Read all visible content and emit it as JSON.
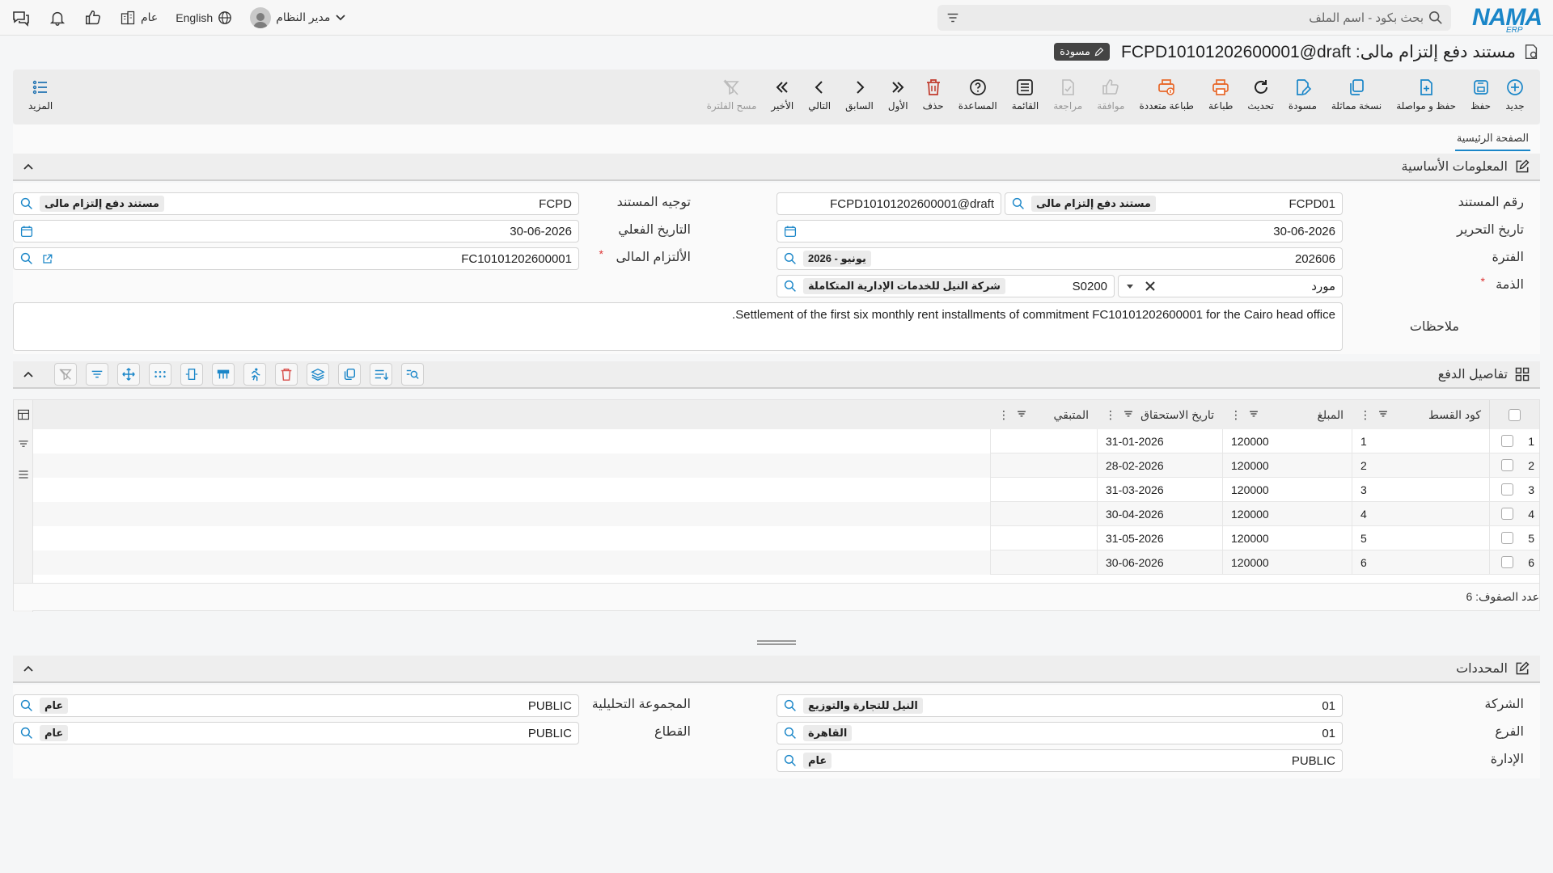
{
  "topbar": {
    "logo_text": "NAMA",
    "logo_sub": "ERP",
    "search_placeholder": "بحث بكود - اسم الملف",
    "user_name": "مدير النظام",
    "language": "English",
    "scope": "عام"
  },
  "title": {
    "text": "مستند دفع إلتزام مالى: FCPD10101202600001@draft",
    "badge": "مسودة"
  },
  "toolbar": {
    "new": "جديد",
    "save": "حفظ",
    "save_continue": "حفظ و مواصلة",
    "duplicate": "نسخة مماثلة",
    "draft": "مسودة",
    "refresh": "تحديث",
    "print": "طباعة",
    "multi_print": "طباعة متعددة",
    "approve": "موافقة",
    "review": "مراجعة",
    "list": "القائمة",
    "help": "المساعدة",
    "delete": "حذف",
    "first": "الأول",
    "previous": "السابق",
    "next": "التالي",
    "last": "الأخير",
    "clear_filter": "مسح الفلترة",
    "more": "المزيد"
  },
  "tabs": {
    "main": "الصفحة الرئيسية"
  },
  "basic": {
    "header": "المعلومات الأساسية",
    "doc_number_label": "رقم المستند",
    "doc_number_code": "FCPD01",
    "doc_number_chip": "مستند دفع إلتزام مالى",
    "doc_number_full": "FCPD10101202600001@draft",
    "doc_direction_label": "توجيه المستند",
    "doc_direction_code": "FCPD",
    "doc_direction_chip": "مستند دفع إلتزام مالى",
    "edit_date_label": "تاريخ التحرير",
    "edit_date": "30-06-2026",
    "actual_date_label": "التاريخ الفعلي",
    "actual_date": "30-06-2026",
    "period_label": "الفترة",
    "period_code": "202606",
    "period_chip": "يونيو - 2026",
    "commitment_label": "الألتزام المالى",
    "commitment_value": "FC10101202600001",
    "party_label": "الذمة",
    "party_type": "مورد",
    "party_code": "S0200",
    "party_chip": "شركة النيل للخدمات الإدارية المتكاملة",
    "notes_label": "ملاحظات",
    "notes": "Settlement of the first six monthly rent installments of commitment FC10101202600001 for the Cairo head office."
  },
  "payments": {
    "header": "تفاصيل الدفع",
    "columns": [
      "كود القسط",
      "المبلغ",
      "تاريخ الاستحقاق",
      "المتبقي"
    ],
    "rows": [
      {
        "n": "1",
        "code": "1",
        "amount": "120000",
        "due": "31-01-2026",
        "rem": ""
      },
      {
        "n": "2",
        "code": "2",
        "amount": "120000",
        "due": "28-02-2026",
        "rem": ""
      },
      {
        "n": "3",
        "code": "3",
        "amount": "120000",
        "due": "31-03-2026",
        "rem": ""
      },
      {
        "n": "4",
        "code": "4",
        "amount": "120000",
        "due": "30-04-2026",
        "rem": ""
      },
      {
        "n": "5",
        "code": "5",
        "amount": "120000",
        "due": "31-05-2026",
        "rem": ""
      },
      {
        "n": "6",
        "code": "6",
        "amount": "120000",
        "due": "30-06-2026",
        "rem": ""
      }
    ],
    "row_count": "عدد الصفوف: 6"
  },
  "dims": {
    "header": "المحددات",
    "company_label": "الشركة",
    "company_code": "01",
    "company_chip": "النيل للتجارة والتوزيع",
    "branch_label": "الفرع",
    "branch_code": "01",
    "branch_chip": "القاهرة",
    "dept_label": "الإدارة",
    "dept_code": "PUBLIC",
    "dept_chip": "عام",
    "analytic_label": "المجموعة التحليلية",
    "analytic_code": "PUBLIC",
    "analytic_chip": "عام",
    "sector_label": "القطاع",
    "sector_code": "PUBLIC",
    "sector_chip": "عام"
  }
}
